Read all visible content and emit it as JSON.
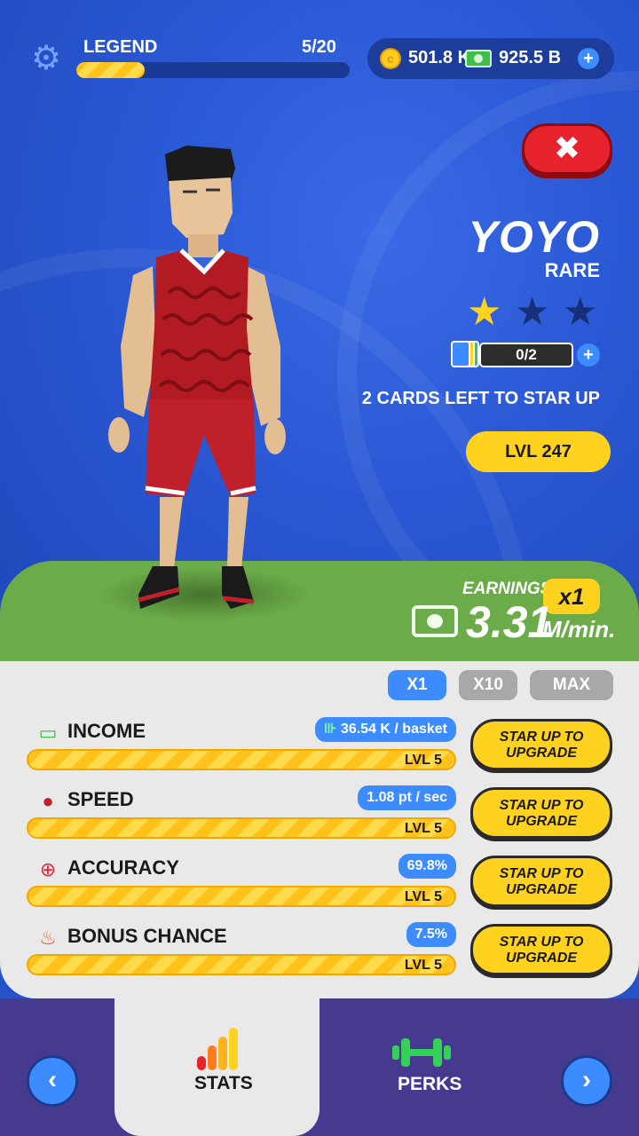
{
  "header": {
    "rank_label": "LEGEND",
    "rank_progress": "5/20",
    "rank_fraction": 0.25,
    "coins": "501.8 K",
    "cash": "925.5 B",
    "plus_glyph": "+",
    "gear_icon": "gear-icon",
    "coin_glyph": "c"
  },
  "close": {
    "glyph": "✖"
  },
  "player": {
    "name": "YOYO",
    "rarity": "RARE",
    "stars_filled": 1,
    "stars_total": 3,
    "cards": "0/2",
    "cards_plus": "+",
    "star_up_text": "2 CARDS LEFT TO STAR UP",
    "level": "LVL 247"
  },
  "earnings": {
    "label": "EARNINGS:",
    "multiplier": "x1",
    "value": "3.31",
    "unit": "M/min."
  },
  "multiplier_tabs": [
    {
      "label": "X1",
      "active": true
    },
    {
      "label": "X10",
      "active": false
    },
    {
      "label": "MAX",
      "active": false
    }
  ],
  "stats": [
    {
      "name": "INCOME",
      "icon": "cash-icon",
      "glyph": "▭",
      "badge": "36.54 K / basket",
      "level": "LVL 5",
      "button": "STAR UP TO UPGRADE",
      "badge_icon": "dumbbell-icon"
    },
    {
      "name": "SPEED",
      "icon": "speed-icon",
      "glyph": "●",
      "badge": "1.08 pt / sec",
      "level": "LVL 5",
      "button": "STAR UP TO UPGRADE"
    },
    {
      "name": "ACCURACY",
      "icon": "target-icon",
      "glyph": "⊕",
      "badge": "69.8%",
      "level": "LVL 5",
      "button": "STAR UP TO UPGRADE"
    },
    {
      "name": "BONUS CHANCE",
      "icon": "fire-icon",
      "glyph": "♨",
      "badge": "7.5%",
      "level": "LVL 5",
      "button": "STAR UP TO UPGRADE"
    }
  ],
  "nav": {
    "prev_glyph": "‹",
    "next_glyph": "›",
    "tabs": [
      {
        "label": "STATS",
        "icon": "bar-chart-icon",
        "active": true
      },
      {
        "label": "PERKS",
        "icon": "dumbbell-icon",
        "active": false
      }
    ]
  },
  "colors": {
    "accent_blue": "#3c8cff",
    "gold": "#ffd21f",
    "nav_purple": "#453a8f",
    "close_red": "#e8232e",
    "perks_green": "#34d058"
  }
}
